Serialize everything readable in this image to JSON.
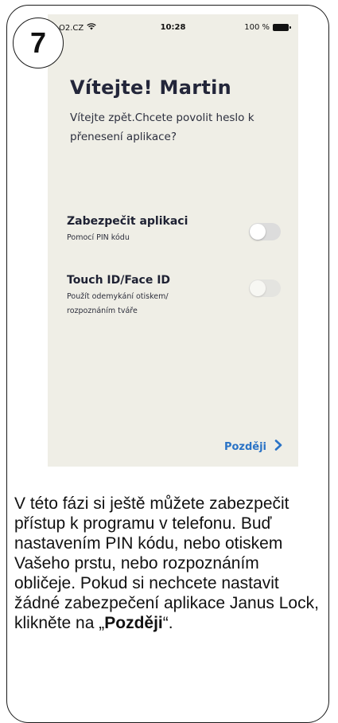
{
  "step": {
    "number": "7"
  },
  "status_bar": {
    "carrier": "O2.CZ",
    "time": "10:28",
    "battery": "100 %"
  },
  "screen": {
    "title": "Vítejte! Martin",
    "subtitle": "Vítejte zpět.Chcete povolit heslo k přenesení aplikace?",
    "options": [
      {
        "title": "Zabezpečit aplikaci",
        "description": "Pomocí PIN kódu",
        "enabled": false
      },
      {
        "title": "Touch ID/Face ID",
        "description": "Použít odemykání otiskem/ rozpoznáním tváře",
        "enabled": false
      }
    ],
    "later_label": "Později"
  },
  "caption": {
    "text_before": "V této fázi si ještě můžete zabezpečit přístup k programu v telefonu. Buď nastavením PIN kódu, nebo otiskem Vašeho prstu, nebo rozpoznáním obličeje. Pokud si nechcete nastavit žádné zabezpečení aplikace Janus Lock, klikněte na „",
    "bold": "Později",
    "text_after": "“."
  },
  "colors": {
    "screen_bg": "#efeee6",
    "accent": "#2a73c6",
    "toggle_off": "#dcdcdc"
  },
  "icons": [
    "wifi-icon",
    "battery-icon",
    "chevron-right-icon"
  ]
}
